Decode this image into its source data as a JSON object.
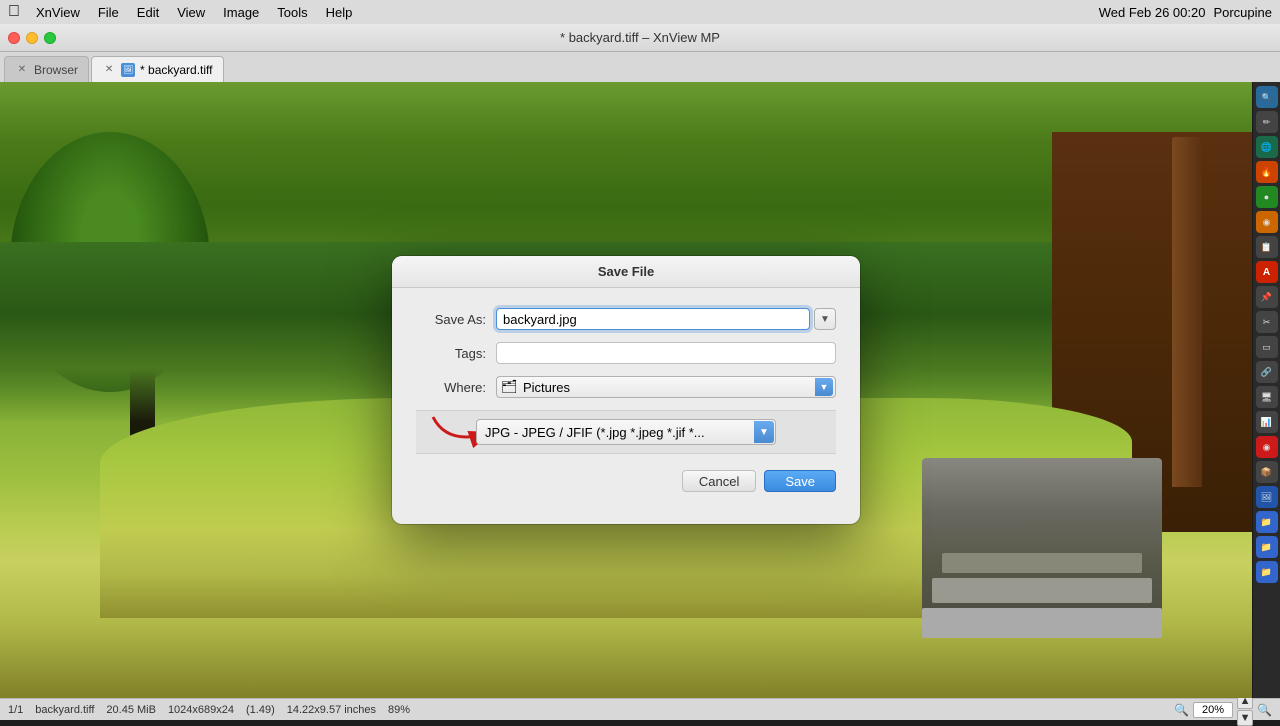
{
  "menubar": {
    "apple": "⌘",
    "items": [
      "XnView",
      "File",
      "Edit",
      "View",
      "Image",
      "Tools",
      "Help"
    ],
    "right_time": "Wed Feb 26  00:20",
    "right_user": "Porcupine"
  },
  "window": {
    "title": "* backyard.tiff – XnView MP",
    "tabs": [
      {
        "id": "browser",
        "label": "Browser",
        "active": false,
        "modified": false
      },
      {
        "id": "backyard",
        "label": "* backyard.tiff",
        "active": true,
        "modified": true
      }
    ]
  },
  "dialog": {
    "title": "Save File",
    "save_as_label": "Save As:",
    "save_as_value": "backyard.jpg",
    "tags_label": "Tags:",
    "tags_value": "",
    "where_label": "Where:",
    "where_value": "Pictures",
    "format_value": "JPG - JPEG / JFIF (*.jpg *.jpeg *.jif *...",
    "cancel_label": "Cancel",
    "save_label": "Save"
  },
  "statusbar": {
    "page_info": "1/1",
    "filename": "backyard.tiff",
    "filesize": "20.45 MiB",
    "dimensions": "1024x689x24",
    "ratio": "(1.49)",
    "physical": "14.22x9.57 inches",
    "zoom": "89%",
    "zoom_display": "20%"
  },
  "sidebar_icons": [
    "🔍",
    "✏️",
    "🔧",
    "🌐",
    "🔥",
    "🟢",
    "📋",
    "A",
    "📌",
    "✂️",
    "📐",
    "🔗",
    "🖥",
    "📊",
    "🔴",
    "📦",
    "🖼",
    "📁",
    "📁",
    "📁"
  ]
}
